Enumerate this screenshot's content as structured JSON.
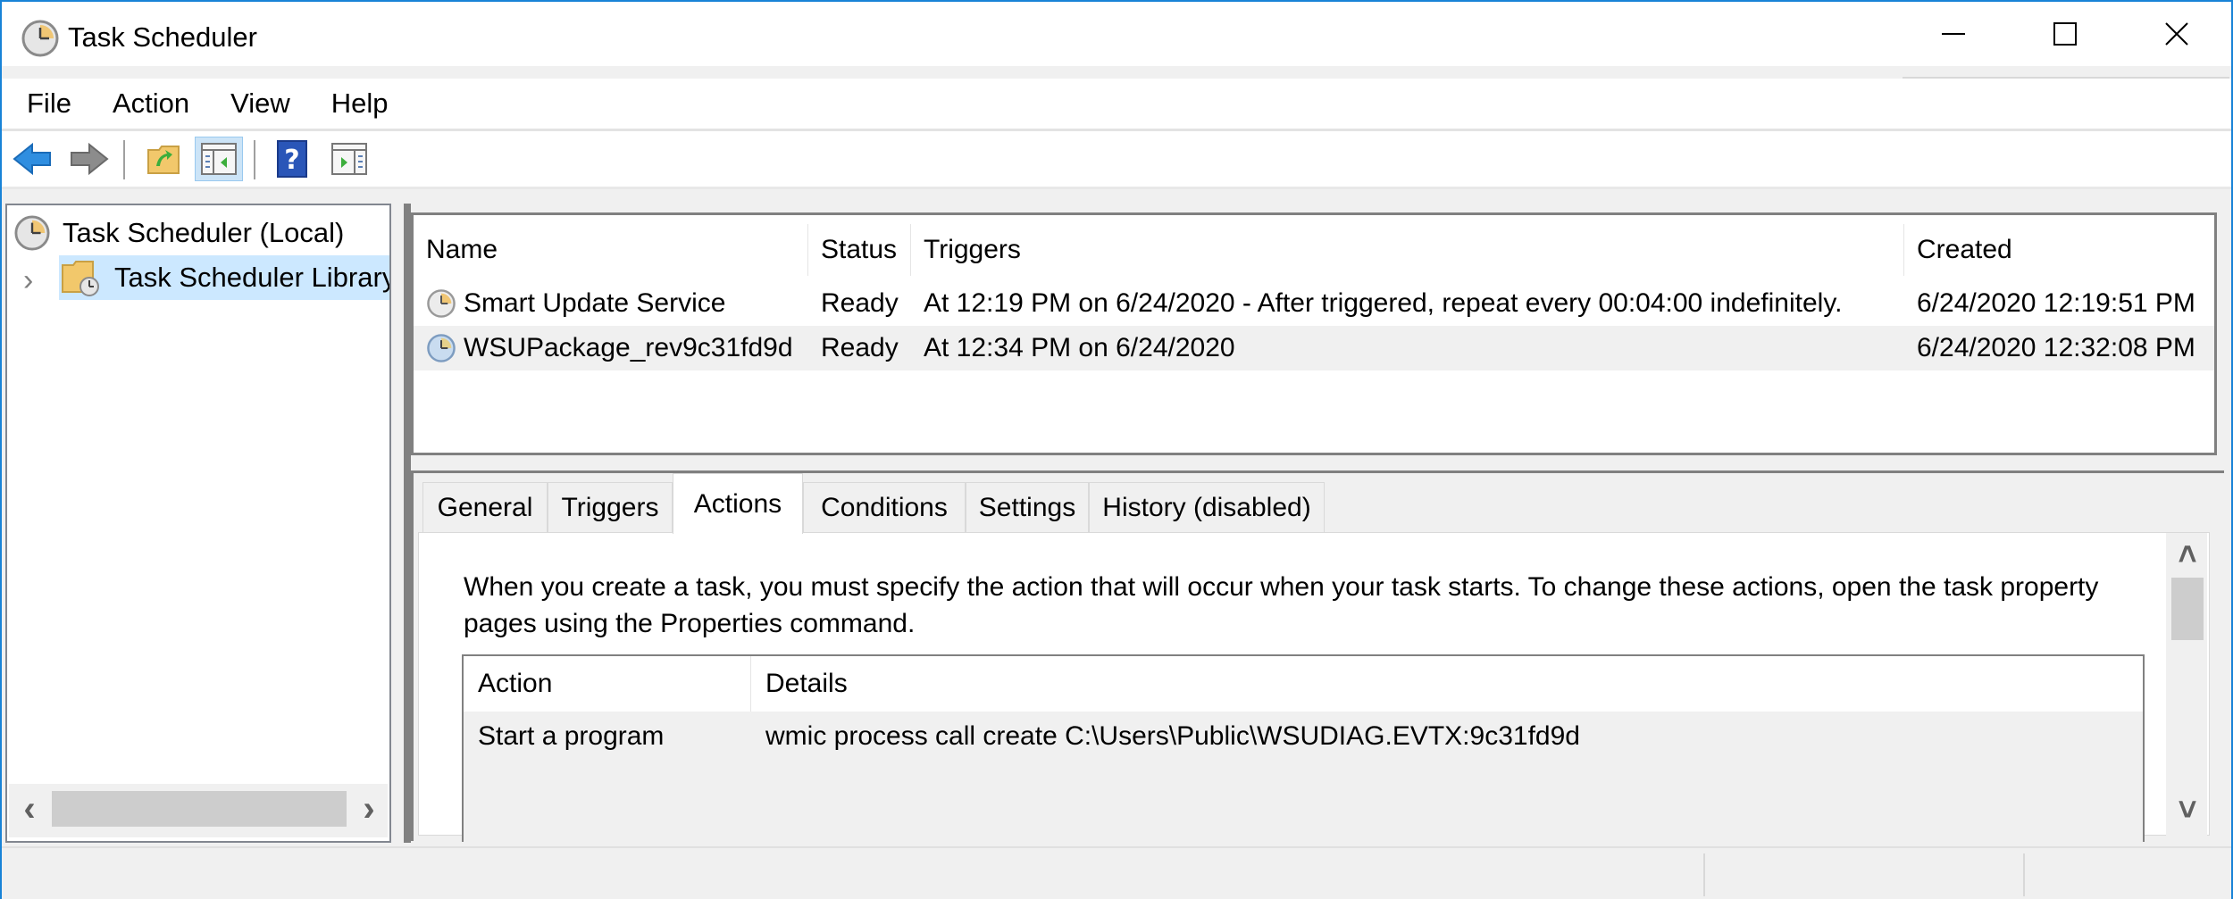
{
  "window": {
    "title": "Task Scheduler",
    "controls": {
      "minimize": "–",
      "maximize": "☐",
      "close": "✕"
    },
    "accent": "#1883d7"
  },
  "menu": {
    "items": [
      "File",
      "Action",
      "View",
      "Help"
    ]
  },
  "toolbar": {
    "buttons": [
      {
        "icon": "back-arrow-icon",
        "tooltip": "Back"
      },
      {
        "icon": "forward-arrow-icon",
        "tooltip": "Forward"
      },
      {
        "icon": "up-folder-icon",
        "tooltip": "Up one level"
      },
      {
        "icon": "show-hide-console-tree-icon",
        "tooltip": "Show/Hide Console Tree",
        "active": true
      },
      {
        "icon": "help-icon",
        "tooltip": "Help"
      },
      {
        "icon": "show-hide-action-pane-icon",
        "tooltip": "Show/Hide Action Pane"
      }
    ]
  },
  "tree": {
    "root": "Task Scheduler (Local)",
    "children": [
      {
        "label": "Task Scheduler Library",
        "selected": true,
        "expander": "›"
      }
    ],
    "scroll_left": "‹",
    "scroll_right": "›"
  },
  "task_list": {
    "columns": [
      "Name",
      "Status",
      "Triggers",
      "Created"
    ],
    "rows": [
      {
        "name": "Smart Update Service",
        "status": "Ready",
        "triggers": "At 12:19 PM on 6/24/2020 - After triggered, repeat every 00:04:00 indefinitely.",
        "created": "6/24/2020 12:19:51 PM"
      },
      {
        "name": "WSUPackage_rev9c31fd9d",
        "status": "Ready",
        "triggers": "At 12:34 PM on 6/24/2020",
        "created": "6/24/2020 12:32:08 PM"
      }
    ]
  },
  "tabs": {
    "items": [
      "General",
      "Triggers",
      "Actions",
      "Conditions",
      "Settings",
      "History (disabled)"
    ],
    "active": "Actions"
  },
  "actions_tab": {
    "description": "When you create a task, you must specify the action that will occur when your task starts.  To change these actions, open the task property pages using the Properties command.",
    "table": {
      "columns": [
        "Action",
        "Details"
      ],
      "rows": [
        {
          "action": "Start a program",
          "details": "wmic process call create C:\\Users\\Public\\WSUDIAG.EVTX:9c31fd9d"
        }
      ]
    },
    "scroll_up": "˄",
    "scroll_down": "˅"
  }
}
